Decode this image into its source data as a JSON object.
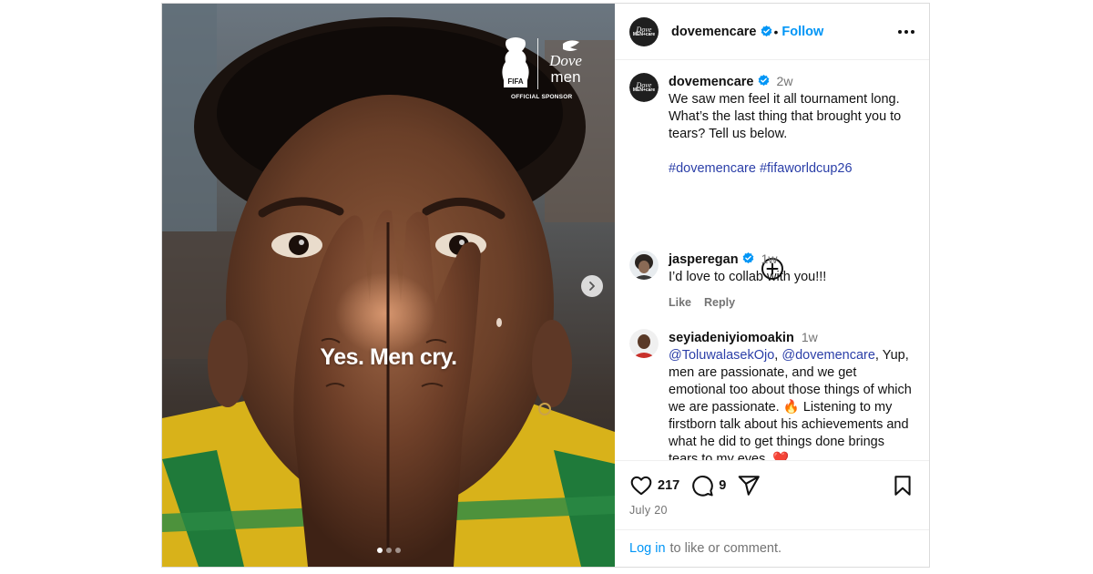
{
  "media": {
    "overlay_text": "Yes. Men cry.",
    "sponsor_label": "OFFICIAL SPONSOR",
    "fifa_text": "FIFA",
    "brand_line1": "Dove",
    "brand_line2": "men",
    "slide_count": 3,
    "active_slide": 1
  },
  "header": {
    "username": "dovemencare",
    "separator": "•",
    "follow_label": "Follow"
  },
  "caption": {
    "username": "dovemencare",
    "time": "2w",
    "text": "We saw men feel it all tournament long. What’s the last thing that brought you to tears? Tell us below.",
    "hashtags": "#dovemencare #fifaworldcup26"
  },
  "comments": [
    {
      "username": "jasperegan",
      "verified": true,
      "time": "1w",
      "text": "I’d love to collab with you!!!",
      "like_label": "Like",
      "reply_label": "Reply"
    },
    {
      "username": "seyiadeniyiomoakin",
      "verified": false,
      "time": "1w",
      "mention1": "@ToluwalasekOjo",
      "mention_sep": ", ",
      "mention2": "@dovemencare",
      "text": ", Yup, men are passionate, and we get emotional too about those things of which we are passionate. 🔥 Listening to my firstborn talk about his achievements and what he did to get things done brings tears to my eyes. ❤️"
    }
  ],
  "footer": {
    "likes": "217",
    "comments": "9",
    "date": "July 20",
    "login_link": "Log in",
    "login_rest": "to like or comment."
  },
  "colors": {
    "accent": "#0095f6",
    "hashtag": "#2b3fa8",
    "muted": "#737373",
    "verified": "#0095f6"
  },
  "icons": [
    "verified-badge-icon",
    "more-options-icon",
    "add-circle-icon",
    "heart-icon",
    "comment-icon",
    "share-icon",
    "bookmark-icon",
    "chevron-right-icon"
  ]
}
